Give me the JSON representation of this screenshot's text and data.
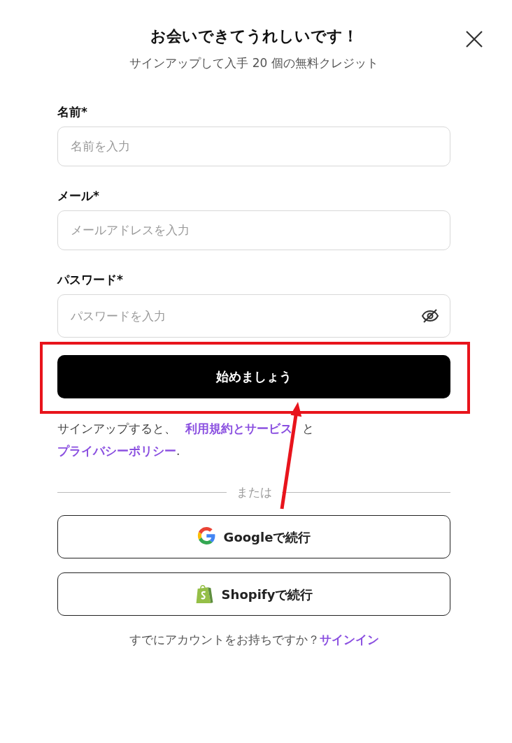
{
  "dialog": {
    "title": "お会いできてうれしいです！",
    "subtitle": "サインアップして入手 20 個の無料クレジット"
  },
  "fields": [
    {
      "label": "名前*",
      "placeholder": "名前を入力",
      "kind": "text"
    },
    {
      "label": "メール*",
      "placeholder": "メールアドレスを入力",
      "kind": "email"
    },
    {
      "label": "パスワード*",
      "placeholder": "パスワードを入力",
      "kind": "password"
    }
  ],
  "submit": {
    "label": "始めましょう",
    "highlighted": true
  },
  "terms": [
    {
      "kind": "text",
      "text": "サインアップすると、 "
    },
    {
      "kind": "link",
      "text": "利用規約とサービス"
    },
    {
      "kind": "text",
      "text": " と "
    },
    {
      "kind": "link",
      "text": "プライバシーポリシー"
    },
    {
      "kind": "text",
      "text": "."
    }
  ],
  "divider": "または",
  "social": [
    {
      "kind": "google",
      "label": "Googleで続行"
    },
    {
      "kind": "shopify",
      "label": "Shopifyで続行"
    }
  ],
  "footer": {
    "text": "すでにアカウントをお持ちですか？",
    "link": "サインイン"
  },
  "annotation": {
    "arrow": true
  }
}
